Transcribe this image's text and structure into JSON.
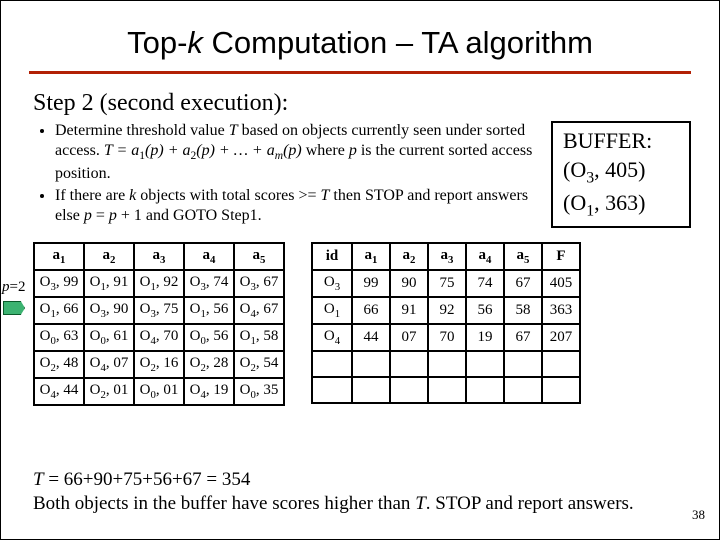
{
  "title_pre": "Top-",
  "title_k": "k",
  "title_post": " Computation – TA algorithm",
  "step": "Step 2 (second execution):",
  "bullet1_a": "Determine threshold value ",
  "bullet1_T": "T",
  "bullet1_b": " based on objects currently seen under sorted access. ",
  "bullet1_eq_a": "T = a",
  "bullet1_eq_1": "1",
  "bullet1_eq_b": "(p) + a",
  "bullet1_eq_2": "2",
  "bullet1_eq_c": "(p) + … + a",
  "bullet1_eq_m": "m",
  "bullet1_eq_d": "(p)",
  "bullet1_c": " where ",
  "bullet1_p": "p",
  "bullet1_d": " is the current sorted access position.",
  "bullet2_a": "If there are ",
  "bullet2_k": "k",
  "bullet2_b": " objects with total scores >= ",
  "bullet2_T": "T",
  "bullet2_c": " then STOP and report answers else ",
  "bullet2_p": "p",
  "bullet2_d": " = ",
  "bullet2_p2": "p",
  "bullet2_e": " + 1 and GOTO Step1.",
  "buffer_title": "BUFFER:",
  "buffer_l1_a": "(O",
  "buffer_l1_sub": "3",
  "buffer_l1_b": ", 405)",
  "buffer_l2_a": "(O",
  "buffer_l2_sub": "1",
  "buffer_l2_b": ", 363)",
  "plabel_a": "p",
  "plabel_b": "=2",
  "left": {
    "h": [
      "a1",
      "a2",
      "a3",
      "a4",
      "a5"
    ],
    "rows": [
      [
        [
          "O",
          "3",
          ", 99"
        ],
        [
          "O",
          "1",
          ", 91"
        ],
        [
          "O",
          "1",
          ", 92"
        ],
        [
          "O",
          "3",
          ", 74"
        ],
        [
          "O",
          "3",
          ", 67"
        ]
      ],
      [
        [
          "O",
          "1",
          ", 66"
        ],
        [
          "O",
          "3",
          ", 90"
        ],
        [
          "O",
          "3",
          ", 75"
        ],
        [
          "O",
          "1",
          ", 56"
        ],
        [
          "O",
          "4",
          ", 67"
        ]
      ],
      [
        [
          "O",
          "0",
          ", 63"
        ],
        [
          "O",
          "0",
          ", 61"
        ],
        [
          "O",
          "4",
          ", 70"
        ],
        [
          "O",
          "0",
          ", 56"
        ],
        [
          "O",
          "1",
          ", 58"
        ]
      ],
      [
        [
          "O",
          "2",
          ", 48"
        ],
        [
          "O",
          "4",
          ", 07"
        ],
        [
          "O",
          "2",
          ", 16"
        ],
        [
          "O",
          "2",
          ", 28"
        ],
        [
          "O",
          "2",
          ", 54"
        ]
      ],
      [
        [
          "O",
          "4",
          ", 44"
        ],
        [
          "O",
          "2",
          ", 01"
        ],
        [
          "O",
          "0",
          ", 01"
        ],
        [
          "O",
          "4",
          ", 19"
        ],
        [
          "O",
          "0",
          ", 35"
        ]
      ]
    ]
  },
  "right": {
    "h": [
      "id",
      "a1",
      "a2",
      "a3",
      "a4",
      "a5",
      "F"
    ],
    "rows": [
      [
        [
          "O",
          "3"
        ],
        "99",
        "90",
        "75",
        "74",
        "67",
        "405"
      ],
      [
        [
          "O",
          "1"
        ],
        "66",
        "91",
        "92",
        "56",
        "58",
        "363"
      ],
      [
        [
          "O",
          "4"
        ],
        "44",
        "07",
        "70",
        "19",
        "67",
        "207"
      ]
    ]
  },
  "bottom_a": "T",
  "bottom_b": " = 66+90+75+56+67 = 354",
  "bottom_c": "Both objects in the buffer have scores higher than ",
  "bottom_d": "T",
  "bottom_e": ". STOP and report answers.",
  "pagenum": "38"
}
